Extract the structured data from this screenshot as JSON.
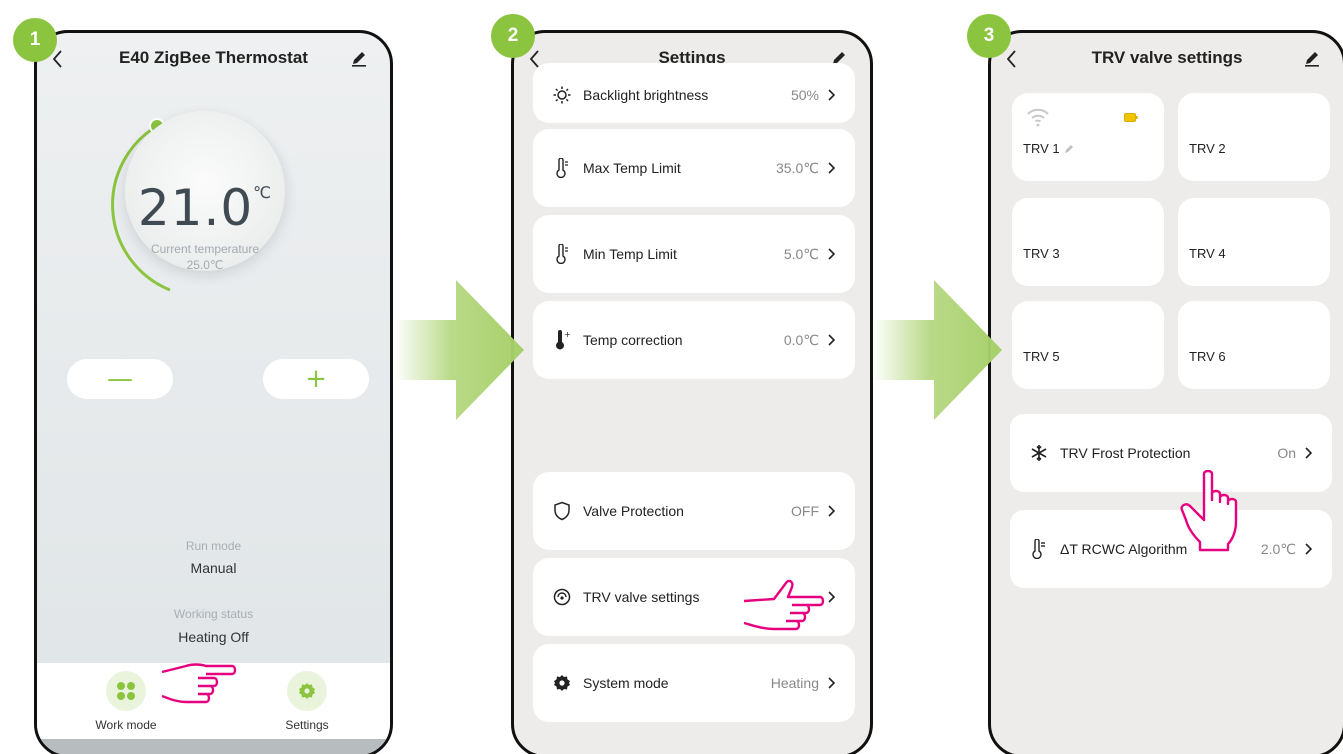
{
  "badges": [
    "1",
    "2",
    "3"
  ],
  "colors": {
    "accent": "#8bc43f",
    "hand": "#e6007e",
    "arrow": "#a7d06a"
  },
  "phone1": {
    "title": "E40 ZigBee Thermostat",
    "setpoint": "21.0",
    "setpoint_unit": "℃",
    "current_label": "Current temperature",
    "current_value": "25.0℃",
    "minus": "—",
    "plus": "+",
    "run_mode_label": "Run mode",
    "run_mode_value": "Manual",
    "status_label": "Working status",
    "status_value": "Heating Off",
    "nav": {
      "work_mode": "Work mode",
      "settings": "Settings"
    }
  },
  "phone2": {
    "title": "Settings",
    "rows": [
      {
        "label": "Backlight brightness",
        "value": "50%",
        "icon": "brightness-icon"
      },
      {
        "label": "Max Temp Limit",
        "value": "35.0℃",
        "icon": "thermometer-icon"
      },
      {
        "label": "Min Temp Limit",
        "value": "5.0℃",
        "icon": "thermometer-icon"
      },
      {
        "label": "Temp correction",
        "value": "0.0℃",
        "icon": "temp-correction-icon"
      },
      {
        "label": "Valve Protection",
        "value": "OFF",
        "icon": "shield-icon"
      },
      {
        "label": "TRV valve settings",
        "value": "",
        "icon": "valve-icon"
      },
      {
        "label": "System mode",
        "value": "Heating",
        "icon": "gear-icon"
      }
    ]
  },
  "phone3": {
    "title": "TRV valve settings",
    "trvs": [
      "TRV 1",
      "TRV 2",
      "TRV 3",
      "TRV 4",
      "TRV 5",
      "TRV 6"
    ],
    "frost_label": "TRV Frost Protection",
    "frost_value": "On",
    "algo_label": "ΔT RCWC Algorithm",
    "algo_value": "2.0℃"
  }
}
